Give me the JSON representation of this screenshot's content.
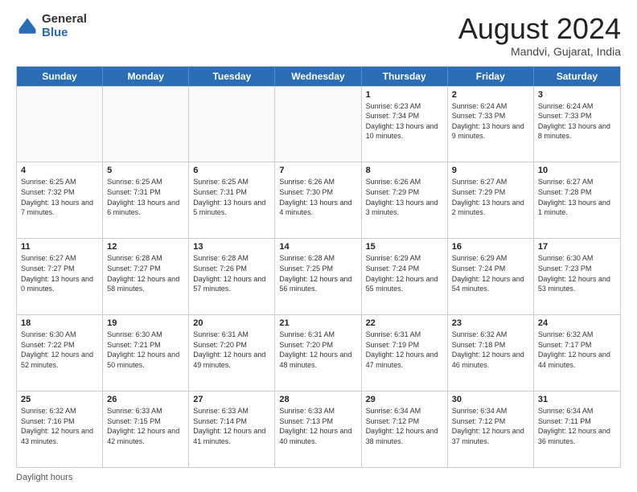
{
  "logo": {
    "general": "General",
    "blue": "Blue"
  },
  "title": "August 2024",
  "location": "Mandvi, Gujarat, India",
  "days_of_week": [
    "Sunday",
    "Monday",
    "Tuesday",
    "Wednesday",
    "Thursday",
    "Friday",
    "Saturday"
  ],
  "footer_text": "Daylight hours",
  "weeks": [
    [
      {
        "day": "",
        "info": ""
      },
      {
        "day": "",
        "info": ""
      },
      {
        "day": "",
        "info": ""
      },
      {
        "day": "",
        "info": ""
      },
      {
        "day": "1",
        "info": "Sunrise: 6:23 AM\nSunset: 7:34 PM\nDaylight: 13 hours and 10 minutes."
      },
      {
        "day": "2",
        "info": "Sunrise: 6:24 AM\nSunset: 7:33 PM\nDaylight: 13 hours and 9 minutes."
      },
      {
        "day": "3",
        "info": "Sunrise: 6:24 AM\nSunset: 7:33 PM\nDaylight: 13 hours and 8 minutes."
      }
    ],
    [
      {
        "day": "4",
        "info": "Sunrise: 6:25 AM\nSunset: 7:32 PM\nDaylight: 13 hours and 7 minutes."
      },
      {
        "day": "5",
        "info": "Sunrise: 6:25 AM\nSunset: 7:31 PM\nDaylight: 13 hours and 6 minutes."
      },
      {
        "day": "6",
        "info": "Sunrise: 6:25 AM\nSunset: 7:31 PM\nDaylight: 13 hours and 5 minutes."
      },
      {
        "day": "7",
        "info": "Sunrise: 6:26 AM\nSunset: 7:30 PM\nDaylight: 13 hours and 4 minutes."
      },
      {
        "day": "8",
        "info": "Sunrise: 6:26 AM\nSunset: 7:29 PM\nDaylight: 13 hours and 3 minutes."
      },
      {
        "day": "9",
        "info": "Sunrise: 6:27 AM\nSunset: 7:29 PM\nDaylight: 13 hours and 2 minutes."
      },
      {
        "day": "10",
        "info": "Sunrise: 6:27 AM\nSunset: 7:28 PM\nDaylight: 13 hours and 1 minute."
      }
    ],
    [
      {
        "day": "11",
        "info": "Sunrise: 6:27 AM\nSunset: 7:27 PM\nDaylight: 13 hours and 0 minutes."
      },
      {
        "day": "12",
        "info": "Sunrise: 6:28 AM\nSunset: 7:27 PM\nDaylight: 12 hours and 58 minutes."
      },
      {
        "day": "13",
        "info": "Sunrise: 6:28 AM\nSunset: 7:26 PM\nDaylight: 12 hours and 57 minutes."
      },
      {
        "day": "14",
        "info": "Sunrise: 6:28 AM\nSunset: 7:25 PM\nDaylight: 12 hours and 56 minutes."
      },
      {
        "day": "15",
        "info": "Sunrise: 6:29 AM\nSunset: 7:24 PM\nDaylight: 12 hours and 55 minutes."
      },
      {
        "day": "16",
        "info": "Sunrise: 6:29 AM\nSunset: 7:24 PM\nDaylight: 12 hours and 54 minutes."
      },
      {
        "day": "17",
        "info": "Sunrise: 6:30 AM\nSunset: 7:23 PM\nDaylight: 12 hours and 53 minutes."
      }
    ],
    [
      {
        "day": "18",
        "info": "Sunrise: 6:30 AM\nSunset: 7:22 PM\nDaylight: 12 hours and 52 minutes."
      },
      {
        "day": "19",
        "info": "Sunrise: 6:30 AM\nSunset: 7:21 PM\nDaylight: 12 hours and 50 minutes."
      },
      {
        "day": "20",
        "info": "Sunrise: 6:31 AM\nSunset: 7:20 PM\nDaylight: 12 hours and 49 minutes."
      },
      {
        "day": "21",
        "info": "Sunrise: 6:31 AM\nSunset: 7:20 PM\nDaylight: 12 hours and 48 minutes."
      },
      {
        "day": "22",
        "info": "Sunrise: 6:31 AM\nSunset: 7:19 PM\nDaylight: 12 hours and 47 minutes."
      },
      {
        "day": "23",
        "info": "Sunrise: 6:32 AM\nSunset: 7:18 PM\nDaylight: 12 hours and 46 minutes."
      },
      {
        "day": "24",
        "info": "Sunrise: 6:32 AM\nSunset: 7:17 PM\nDaylight: 12 hours and 44 minutes."
      }
    ],
    [
      {
        "day": "25",
        "info": "Sunrise: 6:32 AM\nSunset: 7:16 PM\nDaylight: 12 hours and 43 minutes."
      },
      {
        "day": "26",
        "info": "Sunrise: 6:33 AM\nSunset: 7:15 PM\nDaylight: 12 hours and 42 minutes."
      },
      {
        "day": "27",
        "info": "Sunrise: 6:33 AM\nSunset: 7:14 PM\nDaylight: 12 hours and 41 minutes."
      },
      {
        "day": "28",
        "info": "Sunrise: 6:33 AM\nSunset: 7:13 PM\nDaylight: 12 hours and 40 minutes."
      },
      {
        "day": "29",
        "info": "Sunrise: 6:34 AM\nSunset: 7:12 PM\nDaylight: 12 hours and 38 minutes."
      },
      {
        "day": "30",
        "info": "Sunrise: 6:34 AM\nSunset: 7:12 PM\nDaylight: 12 hours and 37 minutes."
      },
      {
        "day": "31",
        "info": "Sunrise: 6:34 AM\nSunset: 7:11 PM\nDaylight: 12 hours and 36 minutes."
      }
    ]
  ]
}
